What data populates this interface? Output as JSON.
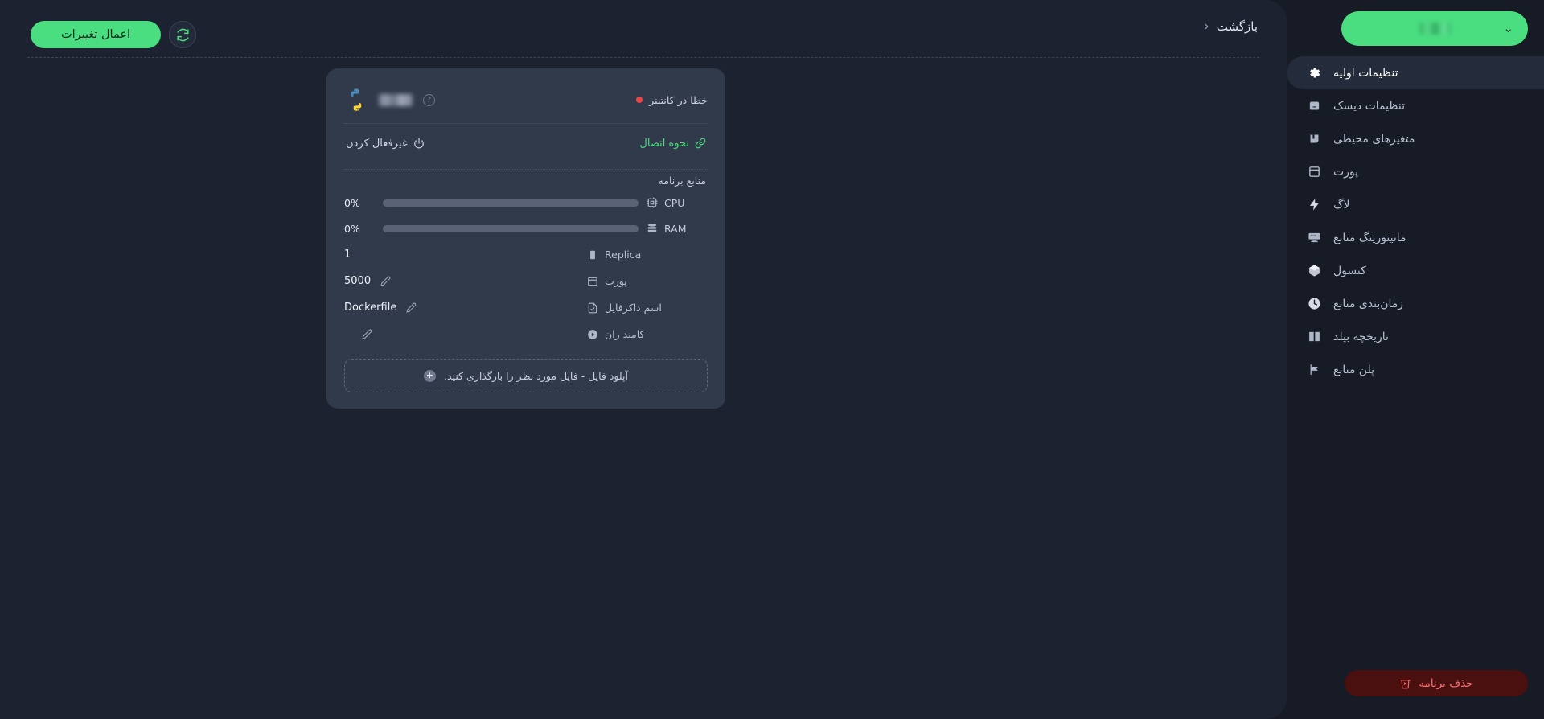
{
  "topbar": {
    "apply_changes_label": "اعمال تغییرات",
    "refresh_icon": "refresh-icon",
    "back_label": "بازگشت",
    "back_chevron": "‹"
  },
  "card": {
    "status_text": "خطا در کانتینر",
    "status_color": "#ef4444",
    "runtime_icon": "python-logo",
    "help_icon": "?",
    "connection_label": "نحوه اتصال",
    "connection_color": "#4ade80",
    "connection_icon": "link-icon",
    "disable_label": "غیرفعال کردن",
    "disable_icon": "power-icon",
    "resources_title": "منابع برنامه",
    "resources": [
      {
        "icon": "cpu-icon",
        "label": "CPU",
        "percent": "0%",
        "value": 0
      },
      {
        "icon": "ram-icon",
        "label": "RAM",
        "percent": "0%",
        "value": 0
      }
    ],
    "fields": [
      {
        "icon": "replica-icon",
        "label": "Replica",
        "value": "1",
        "editable": false
      },
      {
        "icon": "port-icon",
        "label": "پورت",
        "value": "5000",
        "editable": true
      },
      {
        "icon": "dockerfile-icon",
        "label": "اسم داکرفایل",
        "value": "Dockerfile",
        "editable": true
      },
      {
        "icon": "play-icon",
        "label": "کامند ران",
        "value": "",
        "editable": true
      }
    ],
    "upload_text": "آپلود فایل - فایل مورد نظر را بارگذاری کنید.",
    "upload_icon": "plus-circle-icon"
  },
  "sidebar": {
    "app_selector_chevron": "chevron-down-icon",
    "app_selector_value": "",
    "items": [
      {
        "label": "تنظیمات اولیه",
        "icon": "gear-icon",
        "active": true
      },
      {
        "label": "تنظیمات دیسک",
        "icon": "disk-icon",
        "active": false
      },
      {
        "label": "متغیرهای محیطی",
        "icon": "env-icon",
        "active": false
      },
      {
        "label": "پورت",
        "icon": "port-window-icon",
        "active": false
      },
      {
        "label": "لاگ",
        "icon": "bolt-icon",
        "active": false
      },
      {
        "label": "مانیتورینگ منابع",
        "icon": "monitor-icon",
        "active": false
      },
      {
        "label": "کنسول",
        "icon": "cube-icon",
        "active": false
      },
      {
        "label": "زمان‌بندی منابع",
        "icon": "clock-icon",
        "active": false
      },
      {
        "label": "تاریخچه بیلد",
        "icon": "book-icon",
        "active": false
      },
      {
        "label": "پلن منابع",
        "icon": "flag-icon",
        "active": false
      }
    ],
    "delete_label": "حذف برنامه",
    "delete_icon": "trash-x-icon",
    "delete_color": "#f87171"
  }
}
